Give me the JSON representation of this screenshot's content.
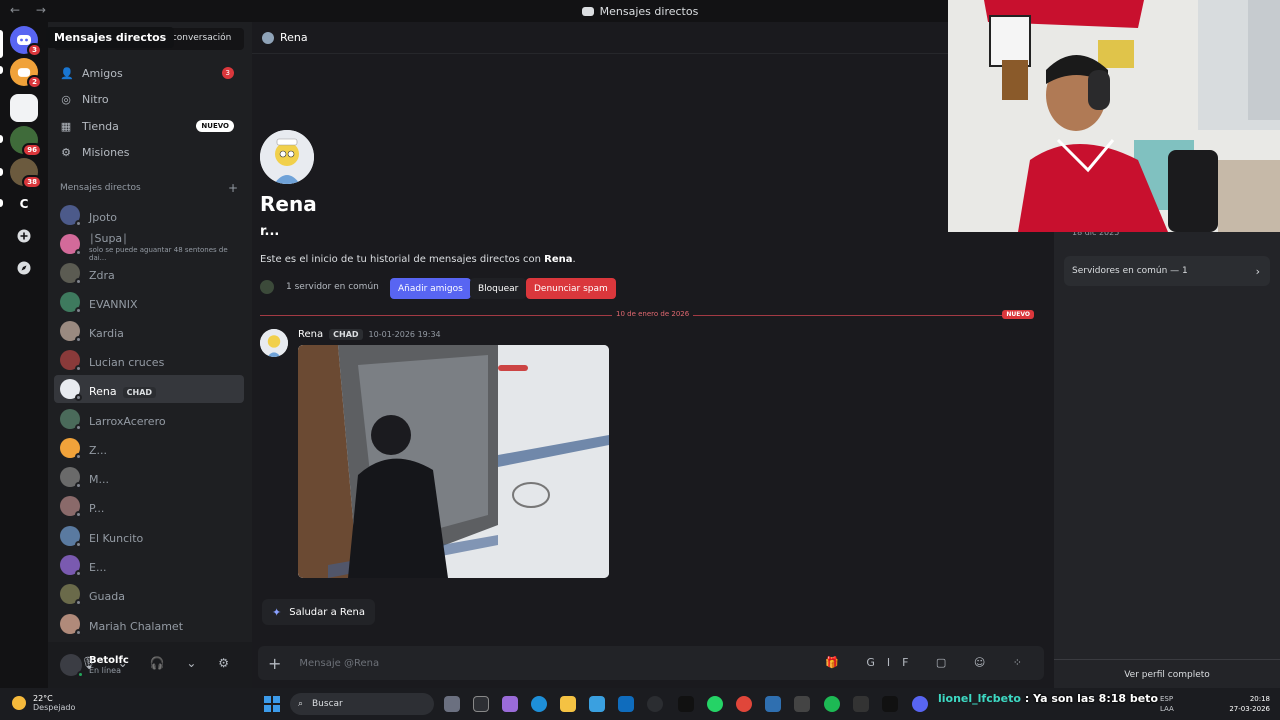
{
  "window": {
    "title": "Mensajes directos",
    "nav": "← →"
  },
  "tooltip": "Mensajes directos",
  "servers": [
    {
      "letter": "",
      "badge": "3",
      "color": "#5865f2"
    },
    {
      "letter": "",
      "badge": "2",
      "color": "#f0a23a"
    },
    {
      "letter": "",
      "badge": "",
      "color": "#f2f3f5"
    },
    {
      "letter": "",
      "badge": "96",
      "color": "#3f6b3a"
    },
    {
      "letter": "",
      "badge": "38",
      "color": "#6b5a3e"
    },
    {
      "letter": "C",
      "badge": "",
      "color": "#121214"
    }
  ],
  "sidebar": {
    "find_text": "una conversación",
    "nav": [
      {
        "label": "Amigos",
        "icon": "friends-icon",
        "count": "3"
      },
      {
        "label": "Nitro",
        "icon": "nitro-icon"
      },
      {
        "label": "Tienda",
        "icon": "shop-icon",
        "tag": "NUEVO"
      },
      {
        "label": "Misiones",
        "icon": "quests-icon"
      }
    ],
    "dm_header": "Mensajes directos",
    "dms": [
      {
        "name": "Jpoto",
        "color": "#4c5a8a"
      },
      {
        "name": "∣Supa∣",
        "sub": "solo se puede aguantar 48 sentones de dai...",
        "color": "#d36a9a"
      },
      {
        "name": "Zdra",
        "color": "#5b5b52"
      },
      {
        "name": "EVANNIX",
        "color": "#3e7a5e"
      },
      {
        "name": "Kardia",
        "color": "#9a8a80"
      },
      {
        "name": "Lucian cruces",
        "color": "#8a3a3a"
      },
      {
        "name": "Rena",
        "tag": "CHAD",
        "color": "#e8ebf0",
        "active": true
      },
      {
        "name": "LarroxAcerero",
        "color": "#4a6a5a"
      },
      {
        "name": "Z...",
        "color": "#f0a23a"
      },
      {
        "name": "M...",
        "color": "#6a6a6a"
      },
      {
        "name": "P...",
        "color": "#8a6a6a"
      },
      {
        "name": "El Kuncito",
        "color": "#5a7aa0"
      },
      {
        "name": "E...",
        "color": "#7a5ab0"
      },
      {
        "name": "Guada",
        "color": "#6a6a4a"
      },
      {
        "name": "Mariah Chalamet",
        "color": "#b08a7a"
      }
    ]
  },
  "user": {
    "name": "Betolfc",
    "status": "En línea",
    "controls": "🎙 ⌄ 🎧 ⌄ ⚙"
  },
  "main": {
    "header_name": "Rena",
    "profile_name": "Rena",
    "profile_tag": "r...",
    "intro_prefix": "Este es el inicio de tu historial de mensajes directos con ",
    "intro_name": "Rena",
    "intro_suffix": ".",
    "common_servers": "1 servidor en común",
    "btn_add": "Añadir amigos",
    "btn_block": "Bloquear",
    "btn_spam": "Denunciar spam",
    "divider_date": "10 de enero de 2026",
    "divider_new": "NUEVO",
    "message": {
      "author": "Rena",
      "tag": "CHAD",
      "time": "10-01-2026 19:34"
    },
    "saludar": "Saludar a Rena",
    "composer_placeholder": "Mensaje @Rena",
    "composer_tools": "🎁 GIF ▢ ☺ ⁘"
  },
  "profile_panel": {
    "joined": "18 dic 2025",
    "servers_common": "Servidores en común — 1",
    "view_full": "Ver perfil completo"
  },
  "taskbar": {
    "temp": "22°C",
    "condition": "Despejado",
    "search": "Buscar",
    "chat_nick": "lionel_lfcbeto",
    "chat_text": ": Ya son las 8:18 beto",
    "lang": "ESP",
    "lang2": "LAA",
    "time": "20:18",
    "date": "27-03-2026"
  },
  "colors": {
    "accent": "#5865f2",
    "danger": "#da373c",
    "online": "#23a55a"
  }
}
